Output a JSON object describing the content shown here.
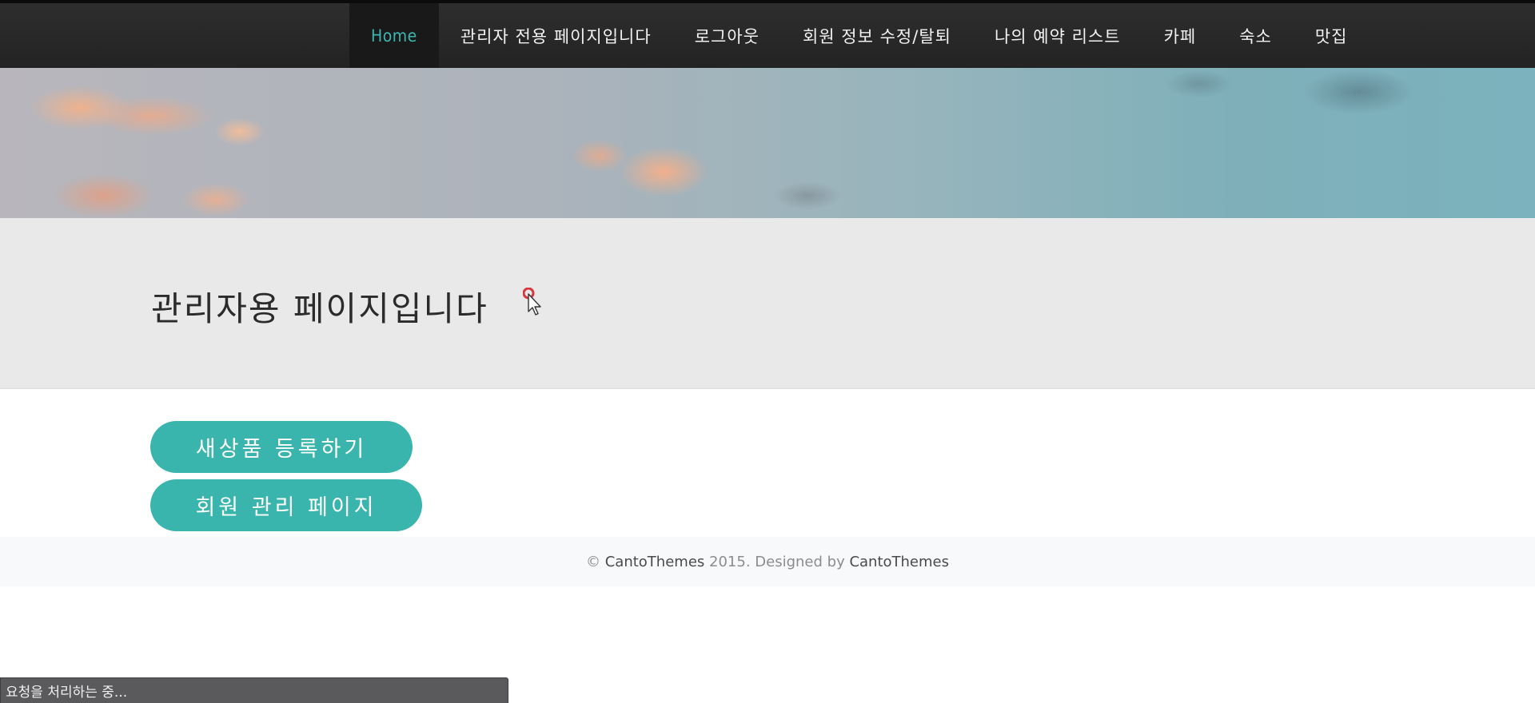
{
  "navbar": {
    "items": [
      {
        "label": "Home",
        "active": true
      },
      {
        "label": "관리자 전용 페이지입니다",
        "active": false
      },
      {
        "label": "로그아웃",
        "active": false
      },
      {
        "label": "회원 정보 수정/탈퇴",
        "active": false
      },
      {
        "label": "나의 예약 리스트",
        "active": false
      },
      {
        "label": "카페",
        "active": false
      },
      {
        "label": "숙소",
        "active": false
      },
      {
        "label": "맛집",
        "active": false
      }
    ],
    "active_color": "#3cb6b0"
  },
  "main": {
    "title": "관리자용 페이지입니다",
    "buttons": {
      "new_product": "새상품 등록하기",
      "member_admin": "회원 관리 페이지"
    },
    "button_color": "#3ab5ad"
  },
  "footer": {
    "copyright_symbol": "©",
    "brand": "CantoThemes",
    "year_text": "2015. Designed by",
    "designer": "CantoThemes"
  },
  "status_bar": {
    "text": "요청을 처리하는 중..."
  }
}
